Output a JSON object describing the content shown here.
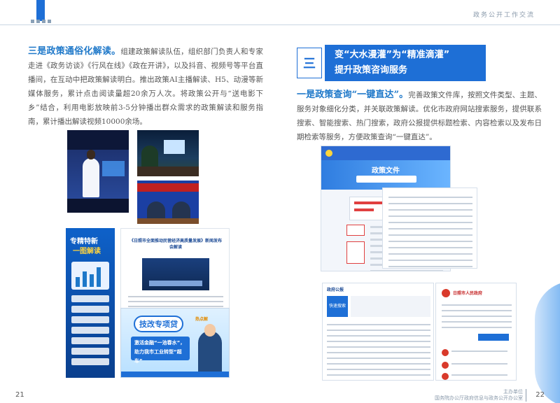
{
  "header": {
    "right_title": "政务公开工作交流"
  },
  "left_page": {
    "lead": "三是政策通俗化解读。",
    "text": "组建政策解读队伍，组织部门负责人和专家走进《政务访谈》《行风在线》《政在开讲》，以及抖音、视频号等平台直播间，在互动中把政策解读明白。推出政策AI主播解读、H5、动漫等新媒体服务，累计点击阅读量超20余万人次。将政策公开与“送电影下乡”结合，利用电影放映前3-5分钟播出群众需求的政策解读和服务指南，累计播出解读视频10000余场。",
    "page_number": "21",
    "poster_title_1": "专精特新",
    "poster_title_2": "一图解读",
    "doc_heading": "《日照市全面推动民营经济高质量发展》新闻发布会解读",
    "tech_badge": "技改专项贷",
    "tech_badge2": "热点解",
    "tech_slogan": "激活金融“一池春水”，助力我市工业转型“超车”"
  },
  "right_page": {
    "section_number": "三",
    "section_title_line1": "变“大水漫灌”为“精准滴灌”",
    "section_title_line2": "提升政策咨询服务",
    "lead": "一是政策查询“一键直达”。",
    "text": "完善政策文件库，按照文件类型、主题、服务对象细化分类，并关联政策解读。优化市政府网站搜索服务，提供联系搜索、智能搜索、热门搜索，政府公报提供标题检索、内容检索以及发布日期检索等服务，方便政策查询“一键直达”。",
    "shot1_banner": "政策文件",
    "shot3_title": "政府公报",
    "shot3_block": "快速搜索",
    "shot4_name": "日照市人民政府",
    "page_number": "22",
    "footer_line1": "主办单位",
    "footer_line2": "国务院办公厅政府信息与政务公开办公室"
  }
}
